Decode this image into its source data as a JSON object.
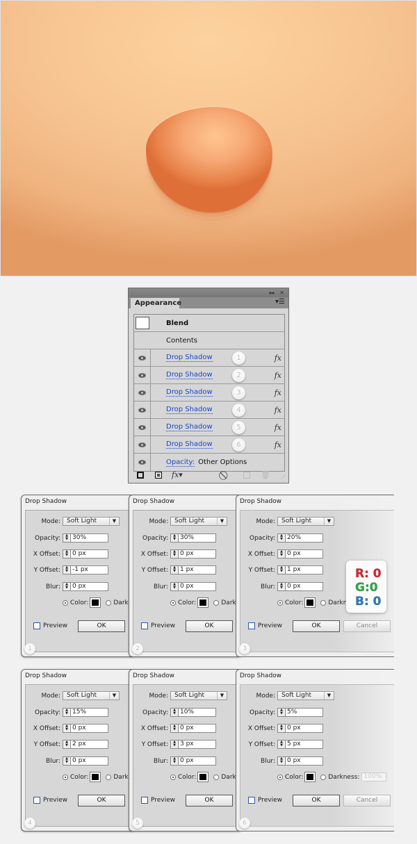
{
  "artwork": {
    "description": "egg-shaped button with stacked drop shadows",
    "colors": {
      "background_light": "#fdd29e",
      "background_dark": "#e39a63",
      "egg_highlight": "#ffc68f",
      "egg_shadow": "#de7037"
    }
  },
  "appearance_panel": {
    "title": "Appearance",
    "header_icons": [
      "collapse-icon",
      "close-icon"
    ],
    "menu_icon": "panel-menu-icon",
    "blend_label": "Blend",
    "contents_label": "Contents",
    "effects": [
      {
        "label": "Drop Shadow",
        "badge": "1"
      },
      {
        "label": "Drop Shadow",
        "badge": "2"
      },
      {
        "label": "Drop Shadow",
        "badge": "3"
      },
      {
        "label": "Drop Shadow",
        "badge": "4"
      },
      {
        "label": "Drop Shadow",
        "badge": "5"
      },
      {
        "label": "Drop Shadow",
        "badge": "6"
      }
    ],
    "fx_label": "fx",
    "opacity_label": "Opacity:",
    "opacity_value": "Other Options",
    "footer_icons": [
      "add-stroke-icon",
      "add-fill-icon",
      "add-effect-icon",
      "clear-appearance-icon",
      "duplicate-item-icon",
      "delete-item-icon"
    ]
  },
  "dialog_common": {
    "title": "Drop Shadow",
    "mode_label": "Mode:",
    "opacity_label": "Opacity:",
    "x_offset_label": "X Offset:",
    "y_offset_label": "Y Offset:",
    "blur_label": "Blur:",
    "color_label": "Color:",
    "darkness_label": "Darkness:",
    "darkness_value": "100%",
    "preview_label": "Preview",
    "ok_label": "OK",
    "cancel_label": "Cancel",
    "color_value": "#000000"
  },
  "dialogs": [
    {
      "number": "1",
      "mode": "Soft Light",
      "opacity": "30%",
      "x_offset": "0 px",
      "y_offset": "-1 px",
      "blur": "0 px",
      "darkness_truncated": "Dark"
    },
    {
      "number": "2",
      "mode": "Soft Light",
      "opacity": "30%",
      "x_offset": "0 px",
      "y_offset": "1 px",
      "blur": "0 px",
      "darkness_truncated": "Dark"
    },
    {
      "number": "3",
      "mode": "Soft Light",
      "opacity": "20%",
      "x_offset": "0 px",
      "y_offset": "1 px",
      "blur": "0 px",
      "darkness_truncated": "Darkn"
    },
    {
      "number": "4",
      "mode": "Soft Light",
      "opacity": "15%",
      "x_offset": "0 px",
      "y_offset": "2 px",
      "blur": "0 px",
      "darkness_truncated": "Dark"
    },
    {
      "number": "5",
      "mode": "Soft Light",
      "opacity": "10%",
      "x_offset": "0 px",
      "y_offset": "3 px",
      "blur": "0 px",
      "darkness_truncated": "Dark"
    },
    {
      "number": "6",
      "mode": "Soft Light",
      "opacity": "5%",
      "x_offset": "0 px",
      "y_offset": "5 px",
      "blur": "0 px",
      "darkness_truncated": "Darkness:"
    }
  ],
  "rgb_callout": {
    "r": "R: 0",
    "g": "G:0",
    "b": "B: 0",
    "colors": {
      "r": "#e0222c",
      "g": "#2daa47",
      "b": "#2b7dc0"
    }
  }
}
